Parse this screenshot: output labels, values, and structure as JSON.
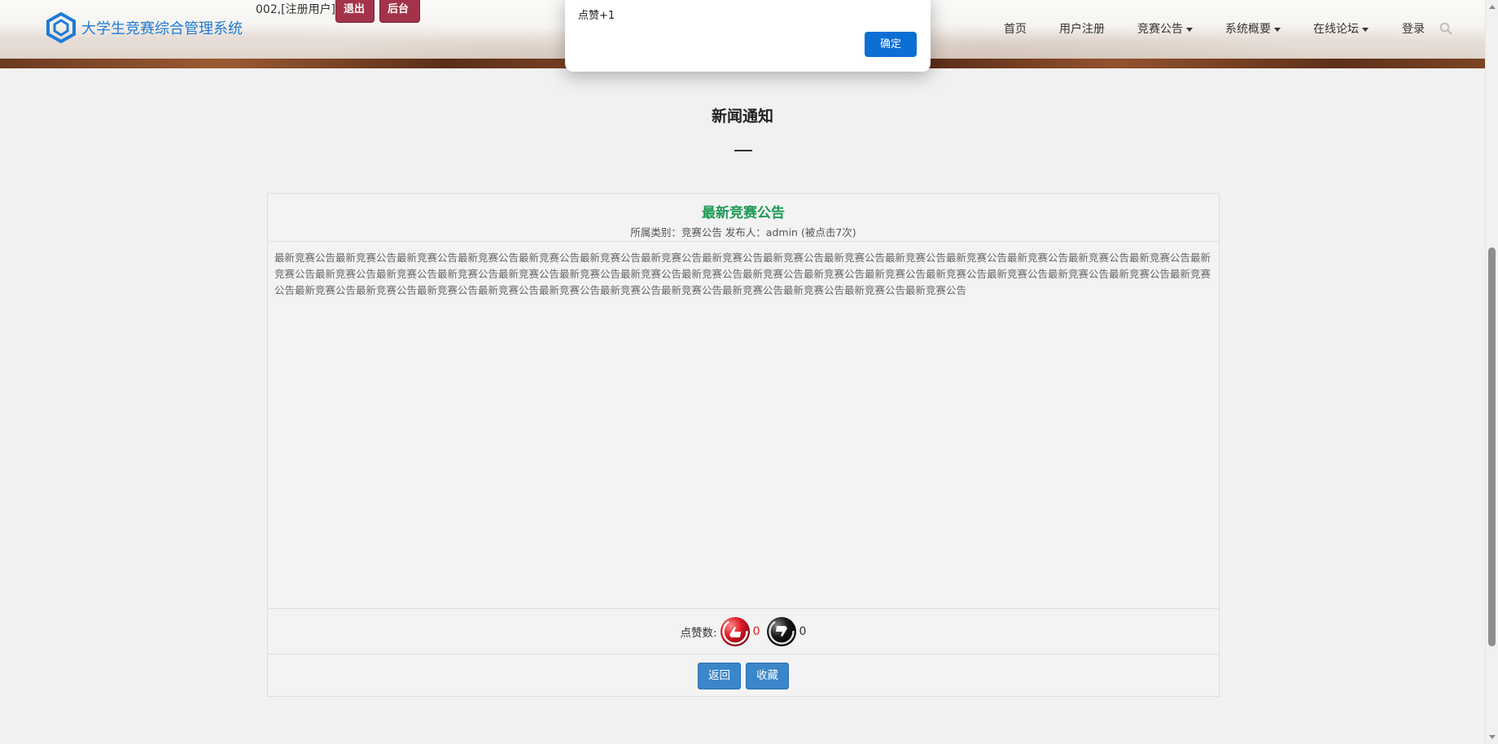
{
  "header": {
    "site_title": "大学生竞赛综合管理系统",
    "user_info": "002,[注册用户]",
    "logout_label": "退出",
    "admin_label": "后台",
    "nav": [
      {
        "label": "首页",
        "dropdown": false
      },
      {
        "label": "用户注册",
        "dropdown": false
      },
      {
        "label": "竞赛公告",
        "dropdown": true
      },
      {
        "label": "系统概要",
        "dropdown": true
      },
      {
        "label": "在线论坛",
        "dropdown": true
      },
      {
        "label": "登录",
        "dropdown": false
      }
    ],
    "search_icon": "search-icon"
  },
  "modal": {
    "message": "点赞+1",
    "ok_label": "确定"
  },
  "section": {
    "title": "新闻通知"
  },
  "article": {
    "title": "最新竞赛公告",
    "meta": "所属类别：竞赛公告 发布人：admin (被点击7次)",
    "body": "最新竞赛公告最新竞赛公告最新竞赛公告最新竞赛公告最新竞赛公告最新竞赛公告最新竞赛公告最新竞赛公告最新竞赛公告最新竞赛公告最新竞赛公告最新竞赛公告最新竞赛公告最新竞赛公告最新竞赛公告最新竞赛公告最新竞赛公告最新竞赛公告最新竞赛公告最新竞赛公告最新竞赛公告最新竞赛公告最新竞赛公告最新竞赛公告最新竞赛公告最新竞赛公告最新竞赛公告最新竞赛公告最新竞赛公告最新竞赛公告最新竞赛公告最新竞赛公告最新竞赛公告最新竞赛公告最新竞赛公告最新竞赛公告最新竞赛公告最新竞赛公告最新竞赛公告最新竞赛公告最新竞赛公告最新竞赛公告",
    "like_label": "点赞数:",
    "like_count": "0",
    "dislike_count": "0",
    "back_label": "返回",
    "favorite_label": "收藏"
  },
  "colors": {
    "accent_blue": "#1f7ad6",
    "header_button": "#a3334a",
    "title_green": "#1e9a55",
    "button_blue": "#3a86c9",
    "modal_button": "#0b6fd4"
  }
}
